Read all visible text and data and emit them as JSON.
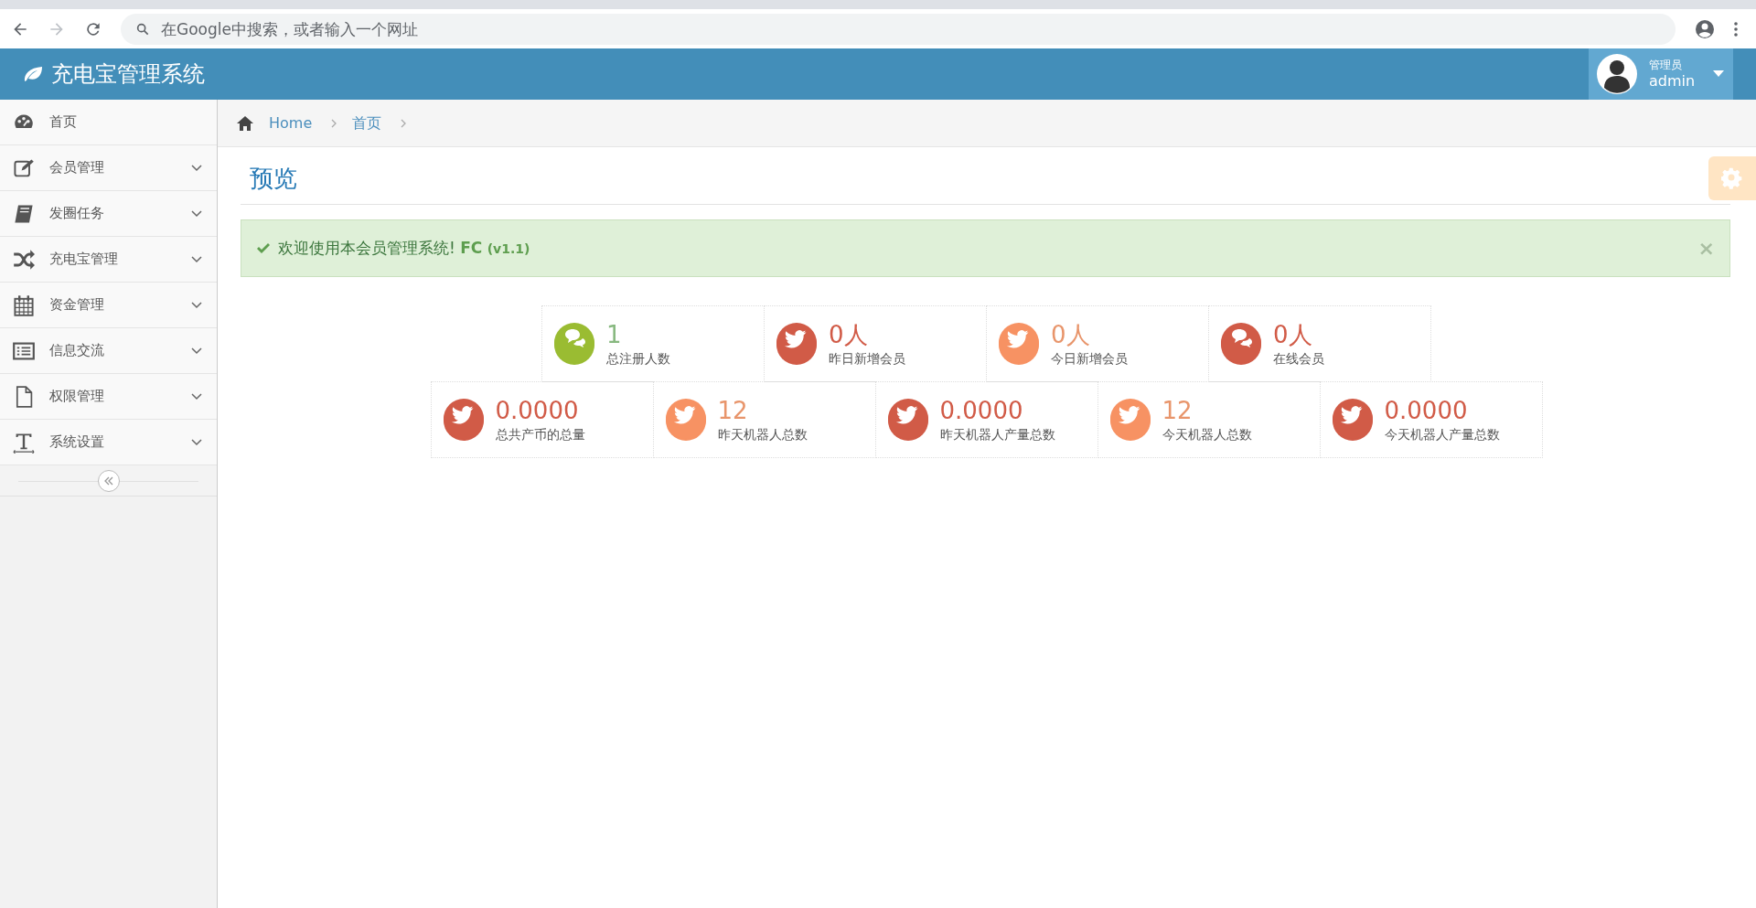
{
  "browser": {
    "address_placeholder": "在Google中搜索，或者输入一个网址"
  },
  "header": {
    "title": "充电宝管理系统",
    "user_role": "管理员",
    "user_name": "admin"
  },
  "sidebar": {
    "items": [
      {
        "label": "首页",
        "expandable": false
      },
      {
        "label": "会员管理",
        "expandable": true
      },
      {
        "label": "发圈任务",
        "expandable": true
      },
      {
        "label": "充电宝管理",
        "expandable": true
      },
      {
        "label": "资金管理",
        "expandable": true
      },
      {
        "label": "信息交流",
        "expandable": true
      },
      {
        "label": "权限管理",
        "expandable": true
      },
      {
        "label": "系统设置",
        "expandable": true
      }
    ]
  },
  "breadcrumb": [
    "Home",
    "首页"
  ],
  "page_title": "预览",
  "alert": {
    "text": "欢迎使用本会员管理系统! **FC** **(v1.1)**",
    "close": "×"
  },
  "stats": [
    [
      {
        "value": "1",
        "label": "总注册人数",
        "kind": "chat",
        "color": "#9abc32"
      },
      {
        "value": "0人",
        "label": "昨日新增会员",
        "kind": "bird",
        "color": "#d15b47"
      },
      {
        "value": "0人",
        "label": "今日新增会员",
        "kind": "bird",
        "color": "#f79263"
      },
      {
        "value": "0人",
        "label": "在线会员",
        "kind": "chat",
        "color": "#d15b47"
      }
    ],
    [
      {
        "value": "0.0000",
        "label": "总共产币的总量",
        "kind": "bird",
        "color": "#d15b47"
      },
      {
        "value": "12",
        "label": "昨天机器人总数",
        "kind": "bird",
        "color": "#f79263"
      },
      {
        "value": "0.0000",
        "label": "昨天机器人产量总数",
        "kind": "bird",
        "color": "#d15b47"
      },
      {
        "value": "12",
        "label": "今天机器人总数",
        "kind": "bird",
        "color": "#f79263"
      },
      {
        "value": "0.0000",
        "label": "今天机器人产量总数",
        "kind": "bird",
        "color": "#d15b47"
      }
    ]
  ]
}
